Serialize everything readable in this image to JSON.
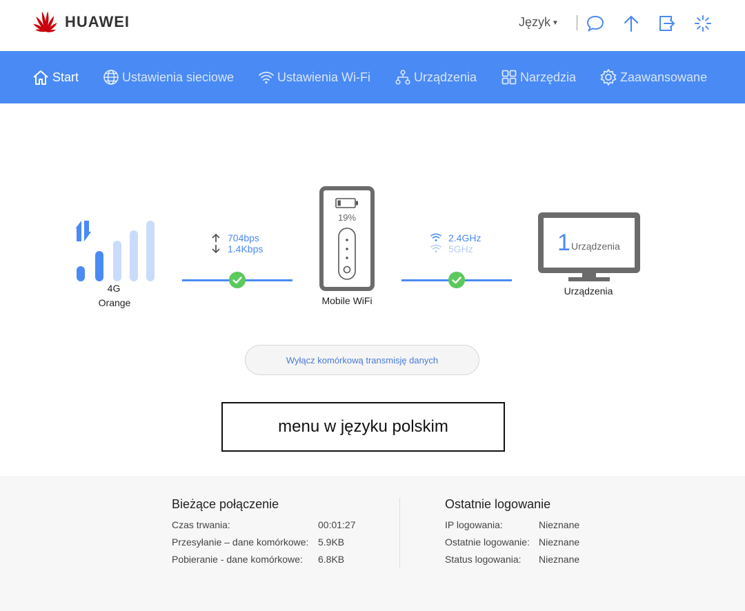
{
  "brand": {
    "name": "HUAWEI",
    "color": "#c7000b"
  },
  "header": {
    "language_label": "Język",
    "icons": [
      "message-icon",
      "upload-icon",
      "logout-icon",
      "loading-icon"
    ]
  },
  "nav": {
    "items": [
      {
        "label": "Start",
        "icon": "home-icon",
        "active": true
      },
      {
        "label": "Ustawienia sieciowe",
        "icon": "globe-icon"
      },
      {
        "label": "Ustawienia Wi-Fi",
        "icon": "wifi-icon"
      },
      {
        "label": "Urządzenia",
        "icon": "network-icon"
      },
      {
        "label": "Narzędzia",
        "icon": "tools-icon"
      },
      {
        "label": "Zaawansowane",
        "icon": "gear-icon"
      }
    ]
  },
  "diagram": {
    "network_type": "4G",
    "operator": "Orange",
    "upload_rate": "704bps",
    "download_rate": "1.4Kbps",
    "device_label": "Mobile WiFi",
    "battery": "19%",
    "battery_level": 0.19,
    "band_24": "2.4GHz",
    "band_5": "5GHz",
    "devices_count": "1",
    "devices_inner_label": "Urządzenia",
    "devices_label": "Urządzenia",
    "signal_bars_active": 2,
    "signal_bars_total": 5
  },
  "data_toggle_label": "Wyłącz komórkową transmisję danych",
  "overlay_label": "menu w języku polskim",
  "current_connection": {
    "title": "Bieżące połączenie",
    "rows": [
      {
        "label": "Czas trwania:",
        "value": "00:01:27"
      },
      {
        "label": "Przesyłanie – dane komórkowe:",
        "value": "5.9KB"
      },
      {
        "label": "Pobieranie - dane komórkowe:",
        "value": "6.8KB"
      }
    ]
  },
  "last_login": {
    "title": "Ostatnie logowanie",
    "rows": [
      {
        "label": "IP logowania:",
        "value": "Nieznane"
      },
      {
        "label": "Ostatnie logowanie:",
        "value": "Nieznane"
      },
      {
        "label": "Status logowania:",
        "value": "Nieznane"
      }
    ]
  },
  "colors": {
    "accent": "#4a8af4",
    "ok": "#5cc95c",
    "inactive_bar": "#c9dcfb",
    "device_gray": "#6b6b6b"
  }
}
